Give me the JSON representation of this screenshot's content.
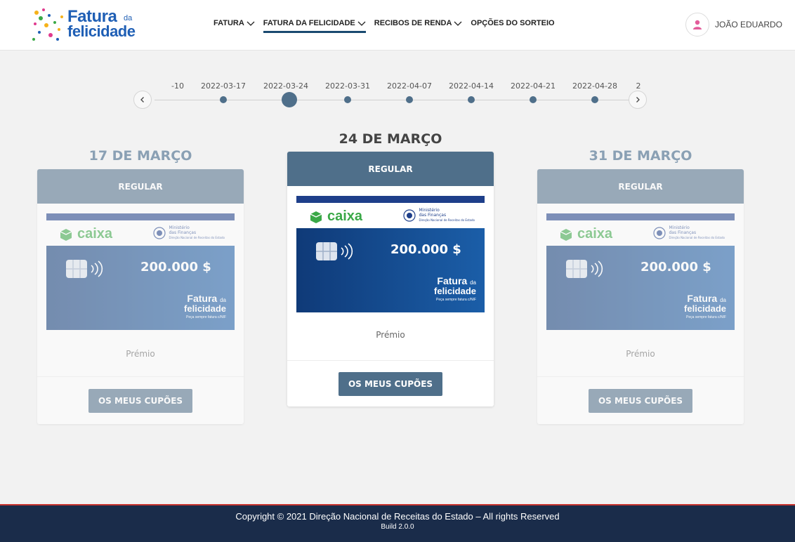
{
  "brand": {
    "logo_line1": "Fatura",
    "logo_da": "da",
    "logo_line2": "felicidade"
  },
  "nav": {
    "items": [
      {
        "label": "FATURA"
      },
      {
        "label": "FATURA DA FELICIDADE"
      },
      {
        "label": "RECIBOS DE RENDA"
      },
      {
        "label": "OPÇÕES DO SORTEIO"
      }
    ]
  },
  "user": {
    "name": "JOÃO EDUARDO"
  },
  "timeline": {
    "dates": [
      "-10",
      "2022-03-17",
      "2022-03-24",
      "2022-03-31",
      "2022-04-07",
      "2022-04-14",
      "2022-04-21",
      "2022-04-28",
      "2"
    ],
    "selected": "2022-03-24"
  },
  "cards": [
    {
      "date_title": "17 DE MARÇO",
      "type": "REGULAR",
      "amount": "200.000 $",
      "prize_label": "Prémio",
      "button": "OS MEUS CUPÕES"
    },
    {
      "date_title": "24 DE MARÇO",
      "type": "REGULAR",
      "amount": "200.000 $",
      "prize_label": "Prémio",
      "button": "OS MEUS CUPÕES"
    },
    {
      "date_title": "31 DE MARÇO",
      "type": "REGULAR",
      "amount": "200.000 $",
      "prize_label": "Prémio",
      "button": "OS MEUS CUPÕES"
    }
  ],
  "ticket": {
    "bank": "caixa",
    "ministry_line1": "Ministério",
    "ministry_line2": "das Finanças",
    "ministry_line3": "Direção Nacional de Receitas do Estado",
    "logo1": "Fatura",
    "logo_da": "da",
    "logo2": "felicidade",
    "tagline": "Peça sempre fatura c/NIF"
  },
  "footer": {
    "copyright": "Copyright © 2021 Direção Nacional de Receitas do Estado – All rights Reserved",
    "build": "Build 2.0.0"
  },
  "colors": {
    "accent": "#4f6f8a",
    "footer_bg": "#1a2c4a",
    "footer_border": "#c8342f",
    "brand_blue": "#1f5fb5",
    "caixa_green": "#3aa847"
  }
}
